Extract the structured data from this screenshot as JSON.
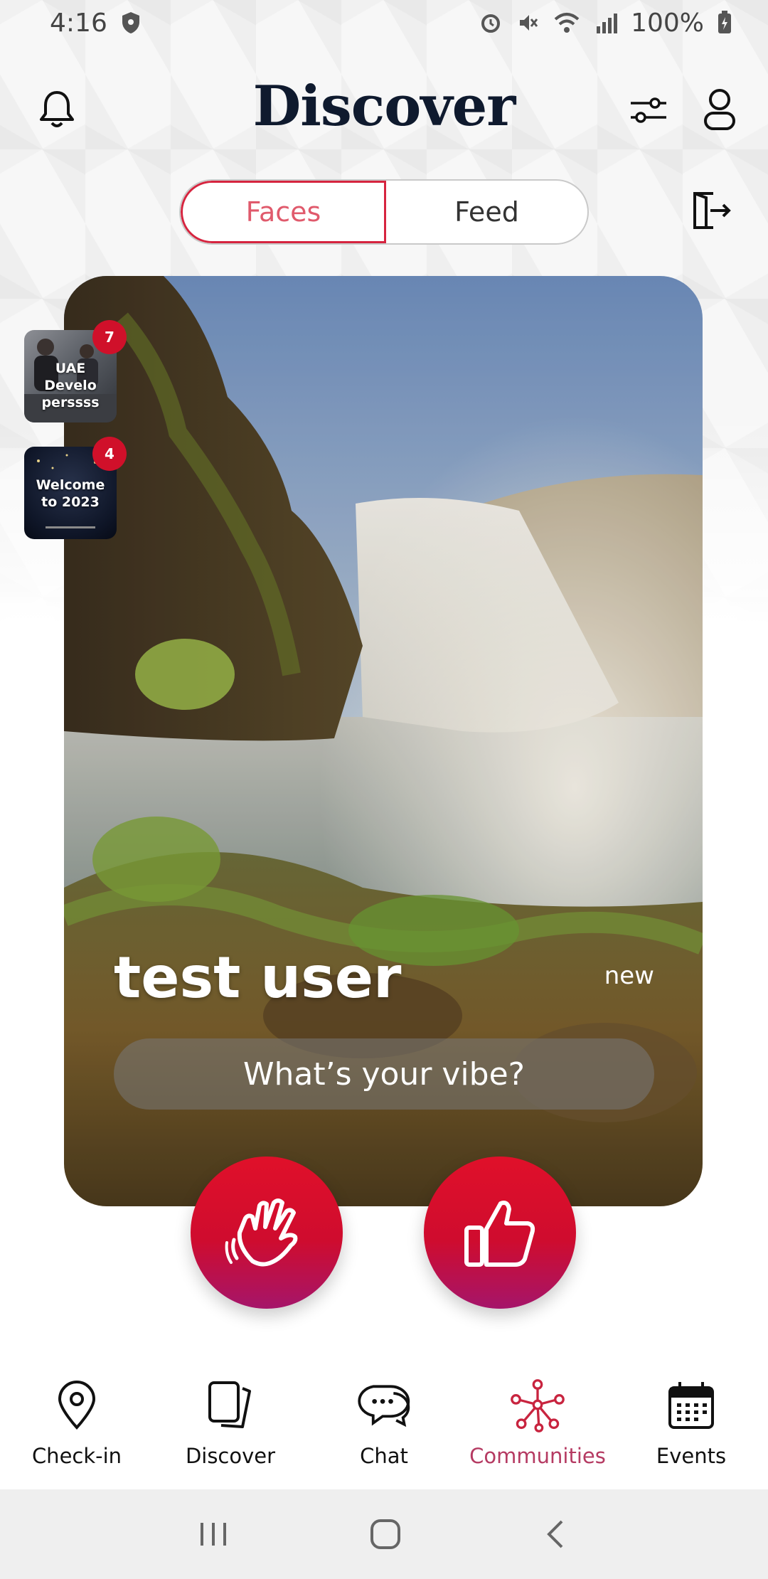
{
  "status_bar": {
    "time": "4:16",
    "battery": "100%",
    "icons": [
      "shield-icon",
      "alarm-icon",
      "mute-icon",
      "wifi-icon",
      "signal-icon",
      "battery-charging-icon"
    ]
  },
  "header": {
    "title": "Discover",
    "left_icon": "bell-icon",
    "right_icons": [
      "filter-sliders-icon",
      "profile-icon"
    ]
  },
  "tabs": {
    "items": [
      {
        "label": "Faces",
        "active": true
      },
      {
        "label": "Feed",
        "active": false
      }
    ],
    "exit_icon": "exit-door-icon"
  },
  "communities": [
    {
      "label": "UAE Develo perssss",
      "badge": "7"
    },
    {
      "label": "Welcome to 2023",
      "badge": "4"
    }
  ],
  "card": {
    "name": "test user",
    "tag": "new",
    "vibe_placeholder": "What’s your vibe?"
  },
  "actions": {
    "wave_icon": "wave-hand-icon",
    "like_icon": "thumbs-up-icon"
  },
  "bottom_nav": {
    "items": [
      {
        "label": "Check-in",
        "icon": "location-pin-icon",
        "active": false
      },
      {
        "label": "Discover",
        "icon": "cards-icon",
        "active": false
      },
      {
        "label": "Chat",
        "icon": "chat-bubbles-icon",
        "active": false
      },
      {
        "label": "Communities",
        "icon": "network-icon",
        "active": true
      },
      {
        "label": "Events",
        "icon": "calendar-icon",
        "active": false
      }
    ]
  },
  "colors": {
    "accent": "#d0102a",
    "accent_gradient_end": "#a5156a",
    "active_nav": "#b53a62",
    "title": "#0f1a2e"
  }
}
